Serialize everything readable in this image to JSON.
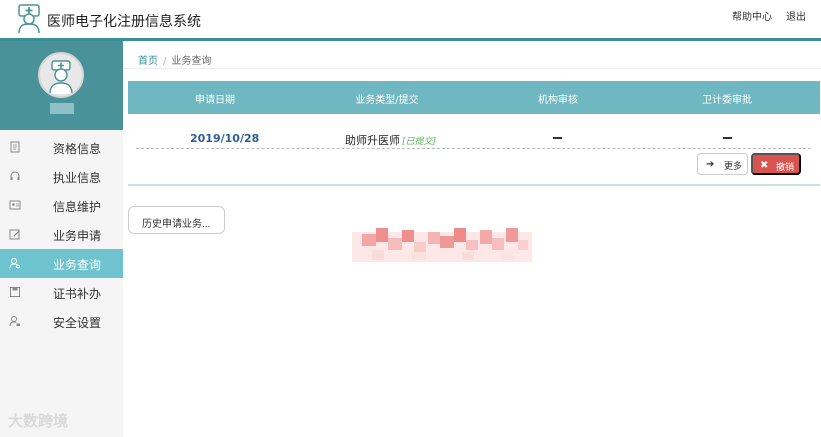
{
  "header": {
    "app_title": "医师电子化注册信息系统",
    "help_link": "帮助中心",
    "logout_link": "退出"
  },
  "sidebar": {
    "items": [
      {
        "label": "资格信息",
        "icon": "document-icon",
        "active": false
      },
      {
        "label": "执业信息",
        "icon": "headset-icon",
        "active": false
      },
      {
        "label": "信息维护",
        "icon": "id-card-icon",
        "active": false
      },
      {
        "label": "业务申请",
        "icon": "edit-icon",
        "active": false
      },
      {
        "label": "业务查询",
        "icon": "user-search-icon",
        "active": true
      },
      {
        "label": "证书补办",
        "icon": "save-icon",
        "active": false
      },
      {
        "label": "安全设置",
        "icon": "user-lock-icon",
        "active": false
      }
    ]
  },
  "breadcrumb": {
    "home": "首页",
    "separator": "/",
    "current": "业务查询"
  },
  "table": {
    "headers": [
      "申请日期",
      "业务类型/提交",
      "机构审核",
      "卫计委审批"
    ],
    "rows": [
      {
        "date": "2019/10/28",
        "type": "助师升医师",
        "status_tag": "[已提交]",
        "org_review": "—",
        "commission_approval": "—"
      }
    ]
  },
  "actions": {
    "more_label": "更多",
    "cancel_label": "撤销",
    "history_label": "历史申请业务..."
  },
  "watermark": "大数跨境",
  "colors": {
    "accent": "#3a8f9a",
    "profile_bg": "#4a929a",
    "active_menu": "#6fc3cf",
    "table_header": "#6fb8c2",
    "cancel_button": "#d9534f",
    "status_tag": "#5cb85c"
  }
}
